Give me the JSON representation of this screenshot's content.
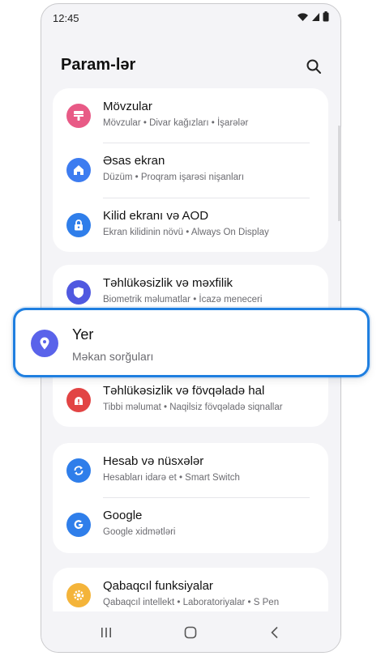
{
  "status_bar": {
    "time": "12:45"
  },
  "header": {
    "title": "Param-lər"
  },
  "groups": [
    {
      "items": [
        {
          "title": "Mövzular",
          "subtitle": "Mövzular  •  Divar kağızları  •  İşarələr",
          "icon": "palette-icon",
          "color": "#e85a86"
        },
        {
          "title": "Əsas ekran",
          "subtitle": "Düzüm  •  Proqram işarəsi nişanları",
          "icon": "home-icon",
          "color": "#3d7cf0"
        },
        {
          "title": "Kilid ekranı və AOD",
          "subtitle": "Ekran kilidinin növü  •  Always On Display",
          "icon": "lock-icon",
          "color": "#2f7eea"
        }
      ]
    },
    {
      "items": [
        {
          "title": "Təhlükəsizlik və məxfilik",
          "subtitle": "Biometrik məlumatlar  •  İcazə meneceri",
          "icon": "shield-icon",
          "color": "#5059e0"
        },
        {
          "title": "Təhlükəsizlik və fövqəladə hal",
          "subtitle": "Tibbi məlumat  •  Naqilsiz fövqəladə siqnallar",
          "icon": "alert-icon",
          "color": "#e24444"
        }
      ]
    },
    {
      "items": [
        {
          "title": "Hesab və nüsxələr",
          "subtitle": "Hesabları idarə et  •  Smart Switch",
          "icon": "sync-icon",
          "color": "#2f7eea"
        },
        {
          "title": "Google",
          "subtitle": "Google xidmətləri",
          "icon": "google-icon",
          "color": "#2f7eea"
        }
      ]
    },
    {
      "items": [
        {
          "title": "Qabaqcıl funksiyalar",
          "subtitle": "Qabaqcıl intellekt  •  Laboratoriyalar  •  S Pen",
          "icon": "gear-star-icon",
          "color": "#f4b43a"
        }
      ]
    }
  ],
  "highlighted": {
    "title": "Yer",
    "subtitle": "Məkan sorğuları",
    "icon": "location-pin-icon",
    "color": "#5a63ea",
    "border_color": "#1f7fe0"
  }
}
